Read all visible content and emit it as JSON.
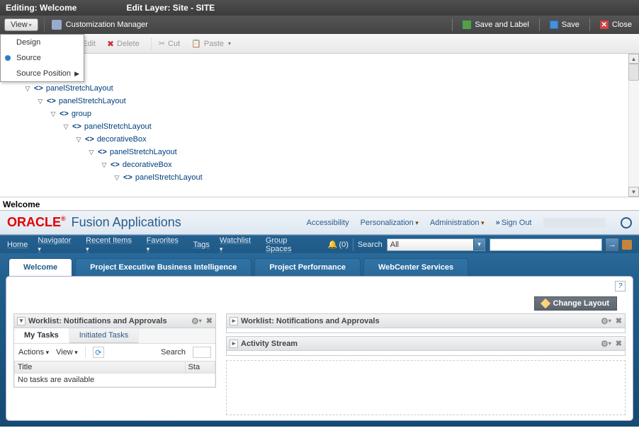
{
  "editor": {
    "title_left": "Editing: Welcome",
    "title_right": "Edit Layer: Site - SITE",
    "view_label": "View",
    "cust_mgr": "Customization Manager",
    "save_label": "Save and Label",
    "save": "Save",
    "close": "Close"
  },
  "view_menu": {
    "design": "Design",
    "source": "Source",
    "source_pos": "Source Position"
  },
  "editbar": {
    "edit": "Edit",
    "delete": "Delete",
    "cut": "Cut",
    "paste": "Paste"
  },
  "tree": {
    "n0": "panelStretchLayout",
    "n1": "panelStretchLayout",
    "n2": "group",
    "n3": "panelStretchLayout",
    "n4": "decorativeBox",
    "n5": "panelStretchLayout",
    "n6": "decorativeBox",
    "n7": "panelStretchLayout"
  },
  "welcome_header": "Welcome",
  "brand": {
    "oracle": "ORACLE",
    "fusion": "Fusion Applications",
    "accessibility": "Accessibility",
    "personalization": "Personalization",
    "administration": "Administration",
    "signout": "Sign Out"
  },
  "nav": {
    "home": "Home",
    "navigator": "Navigator",
    "recent": "Recent Items",
    "favorites": "Favorites",
    "tags": "Tags",
    "watchlist": "Watchlist",
    "groupspaces": "Group Spaces",
    "notif_count": "(0)",
    "search_label": "Search",
    "all": "All"
  },
  "tabs": {
    "welcome": "Welcome",
    "pebi": "Project Executive Business Intelligence",
    "pp": "Project Performance",
    "wcs": "WebCenter Services"
  },
  "workspace": {
    "help": "?",
    "change_layout": "Change Layout",
    "worklist_title": "Worklist: Notifications and Approvals",
    "activity_title": "Activity Stream",
    "my_tasks": "My Tasks",
    "initiated_tasks": "Initiated Tasks",
    "actions": "Actions",
    "view": "View",
    "search": "Search",
    "col_title": "Title",
    "col_status_short": "Sta",
    "no_tasks": "No tasks are available"
  }
}
